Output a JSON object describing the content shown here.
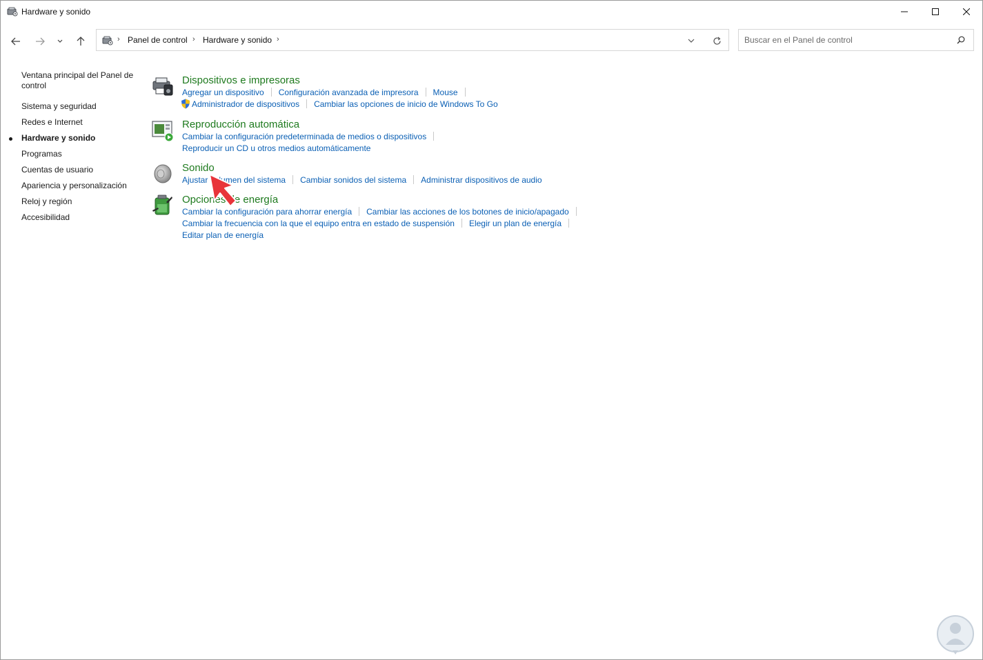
{
  "window": {
    "title": "Hardware y sonido"
  },
  "address": {
    "crumbs": [
      "Panel de control",
      "Hardware y sonido"
    ]
  },
  "search": {
    "placeholder": "Buscar en el Panel de control"
  },
  "sidebar": {
    "home": "Ventana principal del Panel de control",
    "items": [
      {
        "label": "Sistema y seguridad"
      },
      {
        "label": "Redes e Internet"
      },
      {
        "label": "Hardware y sonido",
        "active": true
      },
      {
        "label": "Programas"
      },
      {
        "label": "Cuentas de usuario"
      },
      {
        "label": "Apariencia y personalización"
      },
      {
        "label": "Reloj y región"
      },
      {
        "label": "Accesibilidad"
      }
    ]
  },
  "categories": [
    {
      "title": "Dispositivos e impresoras",
      "icon": "devices-printers-icon",
      "rows": [
        [
          "Agregar un dispositivo",
          "Configuración avanzada de impresora",
          "Mouse"
        ],
        [
          "Administrador de dispositivos",
          "Cambiar las opciones de inicio de Windows To Go"
        ]
      ]
    },
    {
      "title": "Reproducción automática",
      "icon": "autoplay-icon",
      "rows": [
        [
          "Cambiar la configuración predeterminada de medios o dispositivos"
        ],
        [
          "Reproducir un CD u otros medios automáticamente"
        ]
      ]
    },
    {
      "title": "Sonido",
      "icon": "speaker-icon",
      "rows": [
        [
          "Ajustar volumen del sistema",
          "Cambiar sonidos del sistema",
          "Administrar dispositivos de audio"
        ]
      ]
    },
    {
      "title": "Opciones de energía",
      "icon": "power-options-icon",
      "rows": [
        [
          "Cambiar la configuración para ahorrar energía",
          "Cambiar las acciones de los botones de inicio/apagado"
        ],
        [
          "Cambiar la frecuencia con la que el equipo entra en estado de suspensión",
          "Elegir un plan de energía"
        ],
        [
          "Editar plan de energía"
        ]
      ]
    }
  ],
  "colors": {
    "category_title": "#1e7a1e",
    "link": "#0a5fb4",
    "pointer": "#e8343a"
  }
}
